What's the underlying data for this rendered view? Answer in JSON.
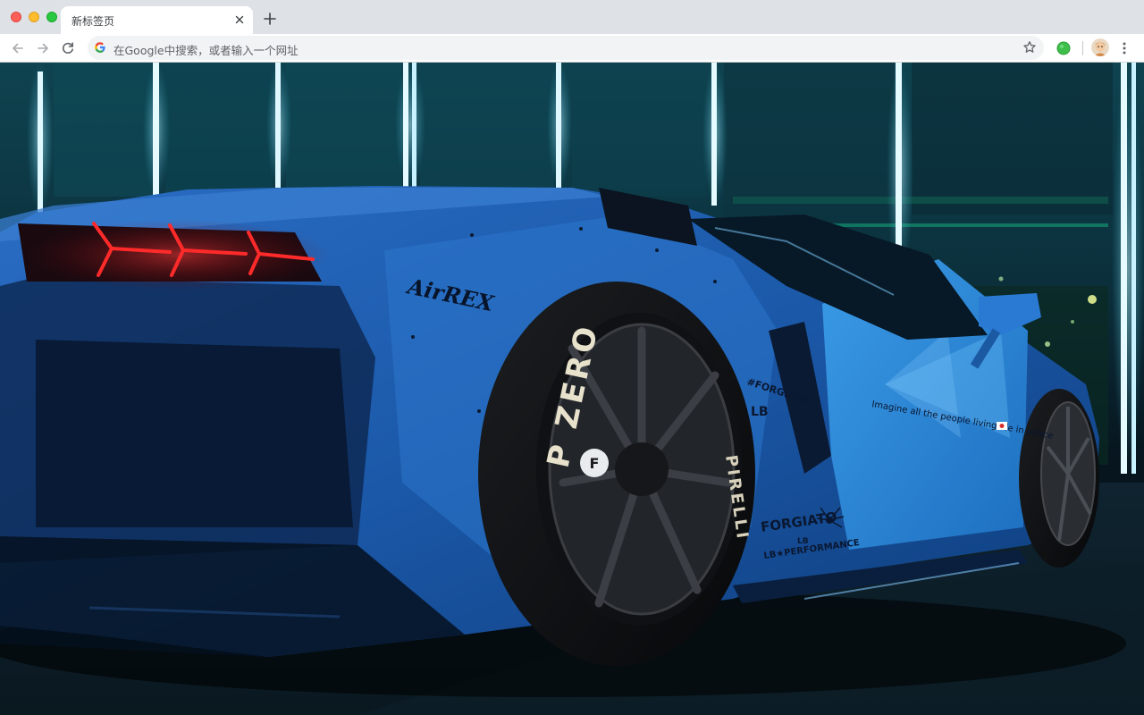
{
  "browser": {
    "tab": {
      "title": "新标签页"
    },
    "omnibox": {
      "placeholder": "在Google中搜索，或者输入一个网址"
    }
  },
  "icons": {
    "back": "back-arrow-icon",
    "forward": "forward-arrow-icon",
    "reload": "reload-icon",
    "google": "google-g-icon",
    "bookmark": "star-icon",
    "extension": "green-circle-extension-icon",
    "profile": "avatar",
    "menu": "vertical-dots-icon",
    "close": "close-icon",
    "new_tab": "plus-icon"
  },
  "wallpaper": {
    "car_decals": {
      "brand_left": "AirREX",
      "forgiato_small": "#FORGIATO",
      "lb_small": "LB",
      "imagine_text": "Imagine all the people living life in peace",
      "forgiato_large": "FORGIATO",
      "lb_large": "LB",
      "lb_performance": "LB★PERFORMANCE",
      "tire_text": "P ZERO",
      "tire_text_right": "PIRELLI",
      "hub_letter": "F"
    }
  },
  "colors": {
    "tabstrip": "#dee1e6",
    "toolbar": "#ffffff",
    "omnibox": "#f1f3f4",
    "car_blue": "#1d6fc4",
    "neon": "#8fe6ff",
    "taillight": "#ff2a2a"
  }
}
